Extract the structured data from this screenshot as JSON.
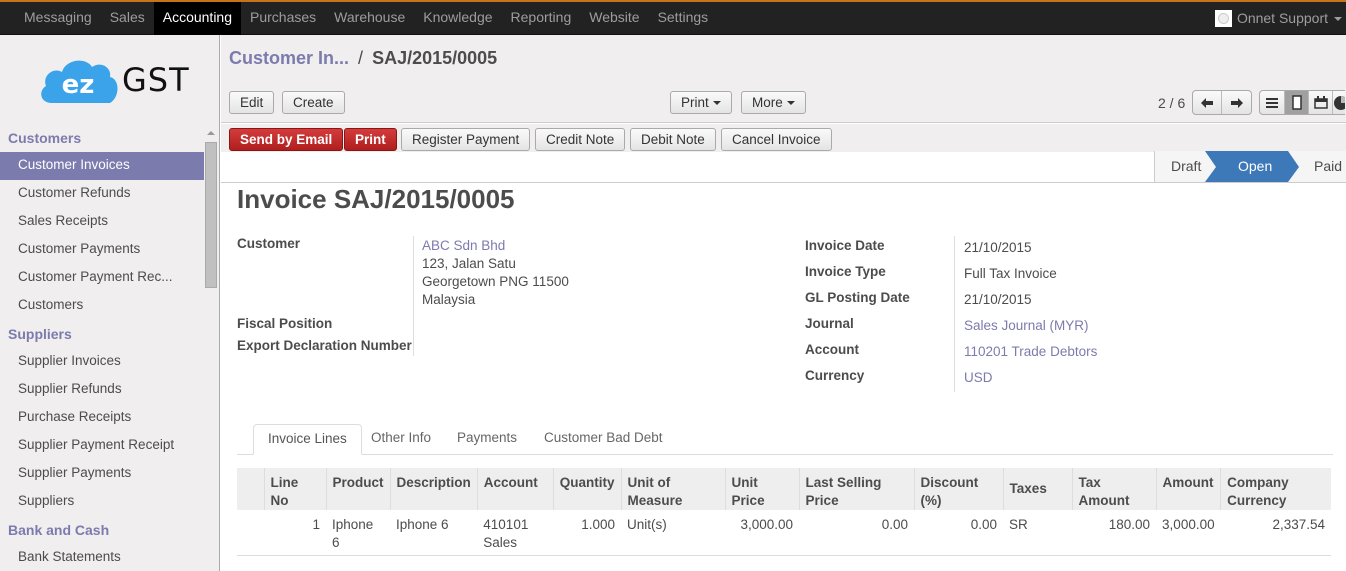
{
  "topbar": {
    "menu": [
      "Messaging",
      "Sales",
      "Accounting",
      "Purchases",
      "Warehouse",
      "Knowledge",
      "Reporting",
      "Website",
      "Settings"
    ],
    "active_index": 2,
    "user": "Onnet Support"
  },
  "logo": {
    "text": "GST",
    "cloud_text": "ez"
  },
  "sidebar": {
    "sections": [
      {
        "title": "Customers",
        "items": [
          "Customer Invoices",
          "Customer Refunds",
          "Sales Receipts",
          "Customer Payments",
          "Customer Payment Rec...",
          "Customers"
        ]
      },
      {
        "title": "Suppliers",
        "items": [
          "Supplier Invoices",
          "Supplier Refunds",
          "Purchase Receipts",
          "Supplier Payment Receipt",
          "Supplier Payments",
          "Suppliers"
        ]
      },
      {
        "title": "Bank and Cash",
        "items": [
          "Bank Statements"
        ]
      }
    ],
    "active_item": "Customer Invoices"
  },
  "breadcrumb": {
    "parent": "Customer In...",
    "separator": "/",
    "current": "SAJ/2015/0005"
  },
  "toolbar": {
    "edit": "Edit",
    "create": "Create",
    "print": "Print",
    "more": "More",
    "pager": "2 / 6"
  },
  "actions": {
    "send_email": "Send by Email",
    "print": "Print",
    "register_payment": "Register Payment",
    "credit_note": "Credit Note",
    "debit_note": "Debit Note",
    "cancel_invoice": "Cancel Invoice"
  },
  "status": {
    "stages": [
      "Draft",
      "Open",
      "Paid"
    ],
    "current": "Open"
  },
  "form": {
    "title": "Invoice SAJ/2015/0005",
    "left": {
      "customer_label": "Customer",
      "customer_name": "ABC Sdn Bhd",
      "address": [
        "123, Jalan Satu",
        "Georgetown PNG 11500",
        "Malaysia"
      ],
      "fiscal_position_label": "Fiscal Position",
      "fiscal_position": "",
      "export_decl_label": "Export Declaration Number",
      "export_decl": ""
    },
    "right": [
      {
        "label": "Invoice Date",
        "value": "21/10/2015",
        "link": false
      },
      {
        "label": "Invoice Type",
        "value": "Full Tax Invoice",
        "link": false
      },
      {
        "label": "GL Posting Date",
        "value": "21/10/2015",
        "link": false
      },
      {
        "label": "Journal",
        "value": "Sales Journal (MYR)",
        "link": true
      },
      {
        "label": "Account",
        "value": "110201 Trade Debtors",
        "link": true
      },
      {
        "label": "Currency",
        "value": "USD",
        "link": true
      }
    ]
  },
  "tabs": [
    "Invoice Lines",
    "Other Info",
    "Payments",
    "Customer Bad Debt"
  ],
  "active_tab": "Invoice Lines",
  "table": {
    "headers": [
      "Line No",
      "Product",
      "Description",
      "Account",
      "Quantity",
      "Unit of Measure",
      "Unit Price",
      "Last Selling Price",
      "Discount (%)",
      "Taxes",
      "Tax Amount",
      "Amount",
      "Company Currency"
    ],
    "rows": [
      [
        "1",
        "Iphone 6",
        "Iphone 6",
        "410101 Sales",
        "1.000",
        "Unit(s)",
        "3,000.00",
        "0.00",
        "0.00",
        "SR",
        "180.00",
        "3,000.00",
        "2,337.54"
      ]
    ]
  }
}
